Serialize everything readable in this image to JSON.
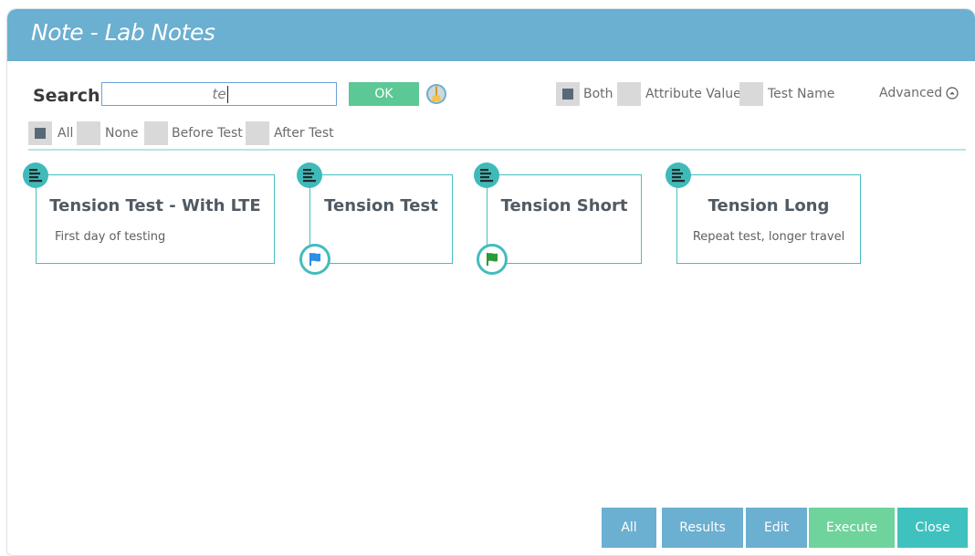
{
  "window": {
    "title": "Note - Lab Notes"
  },
  "search": {
    "label": "Search",
    "value": "te",
    "ok_label": "OK"
  },
  "scope_filters": {
    "both": {
      "label": "Both",
      "checked": true
    },
    "attribute_value": {
      "label": "Attribute Value",
      "checked": false
    },
    "test_name": {
      "label": "Test Name",
      "checked": false
    }
  },
  "advanced_label": "Advanced",
  "time_filters": {
    "all": {
      "label": "All",
      "checked": true
    },
    "none": {
      "label": "None",
      "checked": false
    },
    "before_test": {
      "label": "Before Test",
      "checked": false
    },
    "after_test": {
      "label": "After Test",
      "checked": false
    }
  },
  "cards": [
    {
      "title": "Tension Test - With LTE",
      "description": "First day of testing",
      "flag": null
    },
    {
      "title": "Tension Test",
      "description": "",
      "flag": "blue"
    },
    {
      "title": "Tension Short",
      "description": "",
      "flag": "green"
    },
    {
      "title": "Tension Long",
      "description": "Repeat test, longer travel",
      "flag": null
    }
  ],
  "footer_buttons": {
    "all": "All",
    "results": "Results",
    "edit": "Edit",
    "execute": "Execute",
    "close": "Close"
  },
  "colors": {
    "title_bar": "#6bafd1",
    "ok_button": "#5cc895",
    "card_border": "#48bec1",
    "note_badge": "#3fbab9",
    "flag_blue": "#2b8ee6",
    "flag_green": "#2c9a36",
    "button_blue": "#6bafd1",
    "button_execute": "#6fd39c",
    "button_close": "#3fc1bf"
  }
}
